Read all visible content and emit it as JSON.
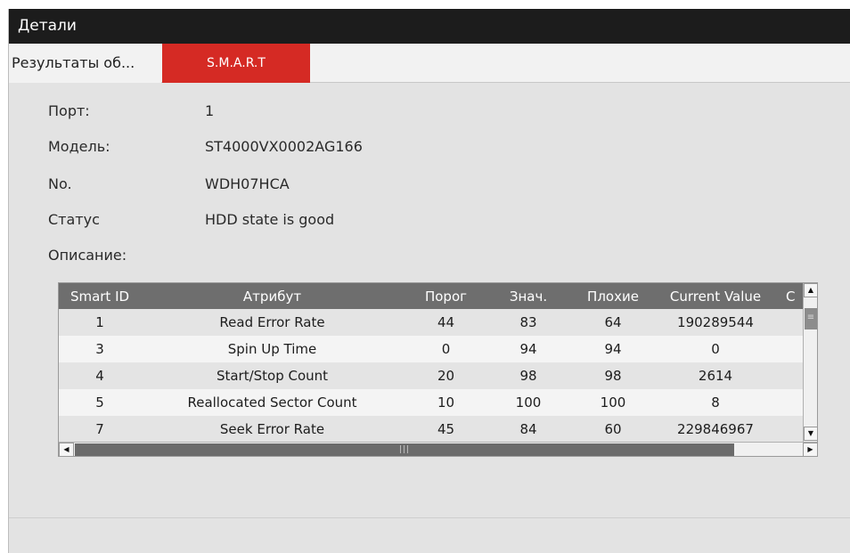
{
  "window": {
    "title": "Детали"
  },
  "tabs": [
    {
      "label": "Результаты об...",
      "active": false
    },
    {
      "label": "S.M.A.R.T",
      "active": true
    }
  ],
  "info": {
    "port_label": "Порт:",
    "port_value": "1",
    "model_label": "Модель:",
    "model_value": "ST4000VX0002AG166",
    "no_label": "No.",
    "no_value": "WDH07HCA",
    "status_label": "Статус",
    "status_value": "HDD state is good",
    "desc_label": "Описание:"
  },
  "smart_table": {
    "columns": [
      "Smart ID",
      "Атрибут",
      "Порог",
      "Знач.",
      "Плохие",
      "Current Value",
      "C"
    ],
    "rows": [
      {
        "id": "1",
        "attribute": "Read Error Rate",
        "threshold": "44",
        "value": "83",
        "worst": "64",
        "current": "190289544"
      },
      {
        "id": "3",
        "attribute": "Spin Up Time",
        "threshold": "0",
        "value": "94",
        "worst": "94",
        "current": "0"
      },
      {
        "id": "4",
        "attribute": "Start/Stop Count",
        "threshold": "20",
        "value": "98",
        "worst": "98",
        "current": "2614"
      },
      {
        "id": "5",
        "attribute": "Reallocated Sector Count",
        "threshold": "10",
        "value": "100",
        "worst": "100",
        "current": "8"
      },
      {
        "id": "7",
        "attribute": "Seek Error Rate",
        "threshold": "45",
        "value": "84",
        "worst": "60",
        "current": "229846967"
      }
    ]
  },
  "icons": {
    "scroll_up": "▲",
    "scroll_down": "▼",
    "scroll_left": "◀",
    "scroll_right": "▶",
    "v_grip": "≡",
    "h_grip": "|||"
  },
  "colors": {
    "titlebar": "#1c1c1c",
    "active_tab": "#d52a24",
    "table_header": "#6e6e6e"
  }
}
